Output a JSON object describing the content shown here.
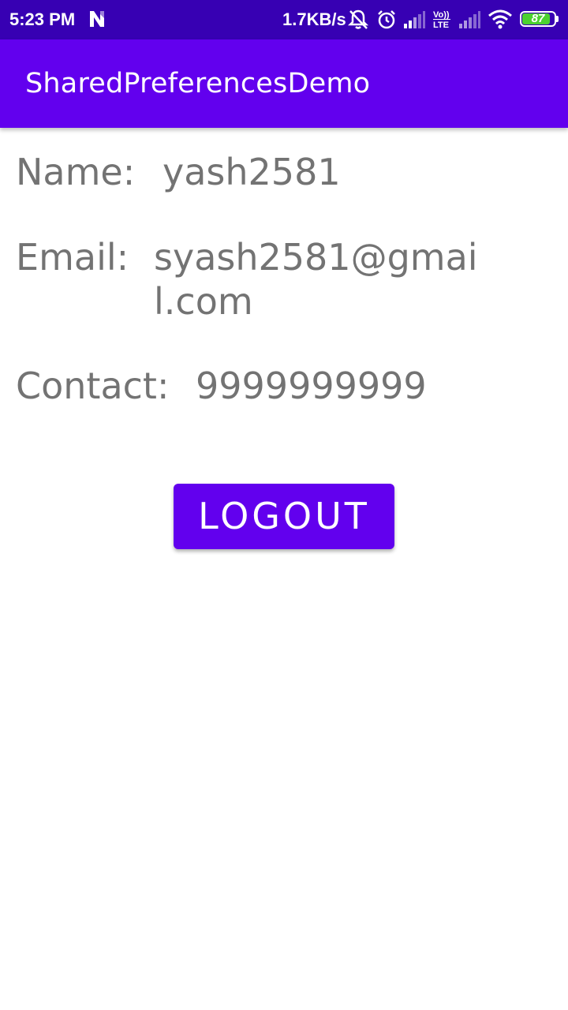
{
  "status_bar": {
    "time": "5:23 PM",
    "network_speed": "1.7KB/s",
    "battery_level": "87",
    "battery_percent": 87,
    "volte_label": "Vo)) LTE",
    "colors": {
      "background": "#3700B3",
      "battery_fill": "#4CD130"
    }
  },
  "app_bar": {
    "title": "SharedPreferencesDemo",
    "color": "#6200EE"
  },
  "profile": {
    "name_label": "Name:",
    "name_value": "yash2581",
    "email_label": "Email:",
    "email_value": "syash2581@gmail.com",
    "contact_label": "Contact:",
    "contact_value": "9999999999"
  },
  "actions": {
    "logout_label": "LOGOUT"
  },
  "icons": [
    "n-notification-icon",
    "mute-bell-icon",
    "alarm-icon",
    "signal-icon",
    "volte-icon",
    "wifi-icon",
    "battery-icon"
  ]
}
